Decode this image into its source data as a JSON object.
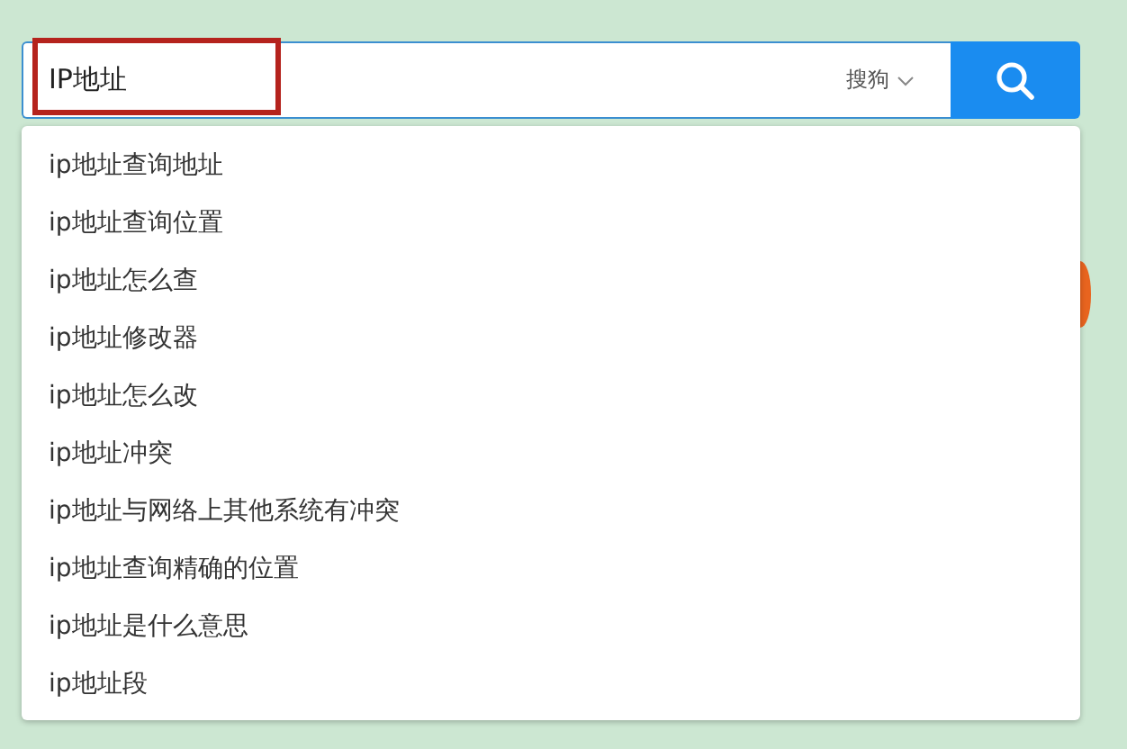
{
  "search": {
    "value": "IP地址",
    "engine": "搜狗",
    "highlighted": true
  },
  "suggestions": [
    "ip地址查询地址",
    "ip地址查询位置",
    "ip地址怎么查",
    "ip地址修改器",
    "ip地址怎么改",
    "ip地址冲突",
    "ip地址与网络上其他系统有冲突",
    "ip地址查询精确的位置",
    "ip地址是什么意思",
    "ip地址段"
  ]
}
